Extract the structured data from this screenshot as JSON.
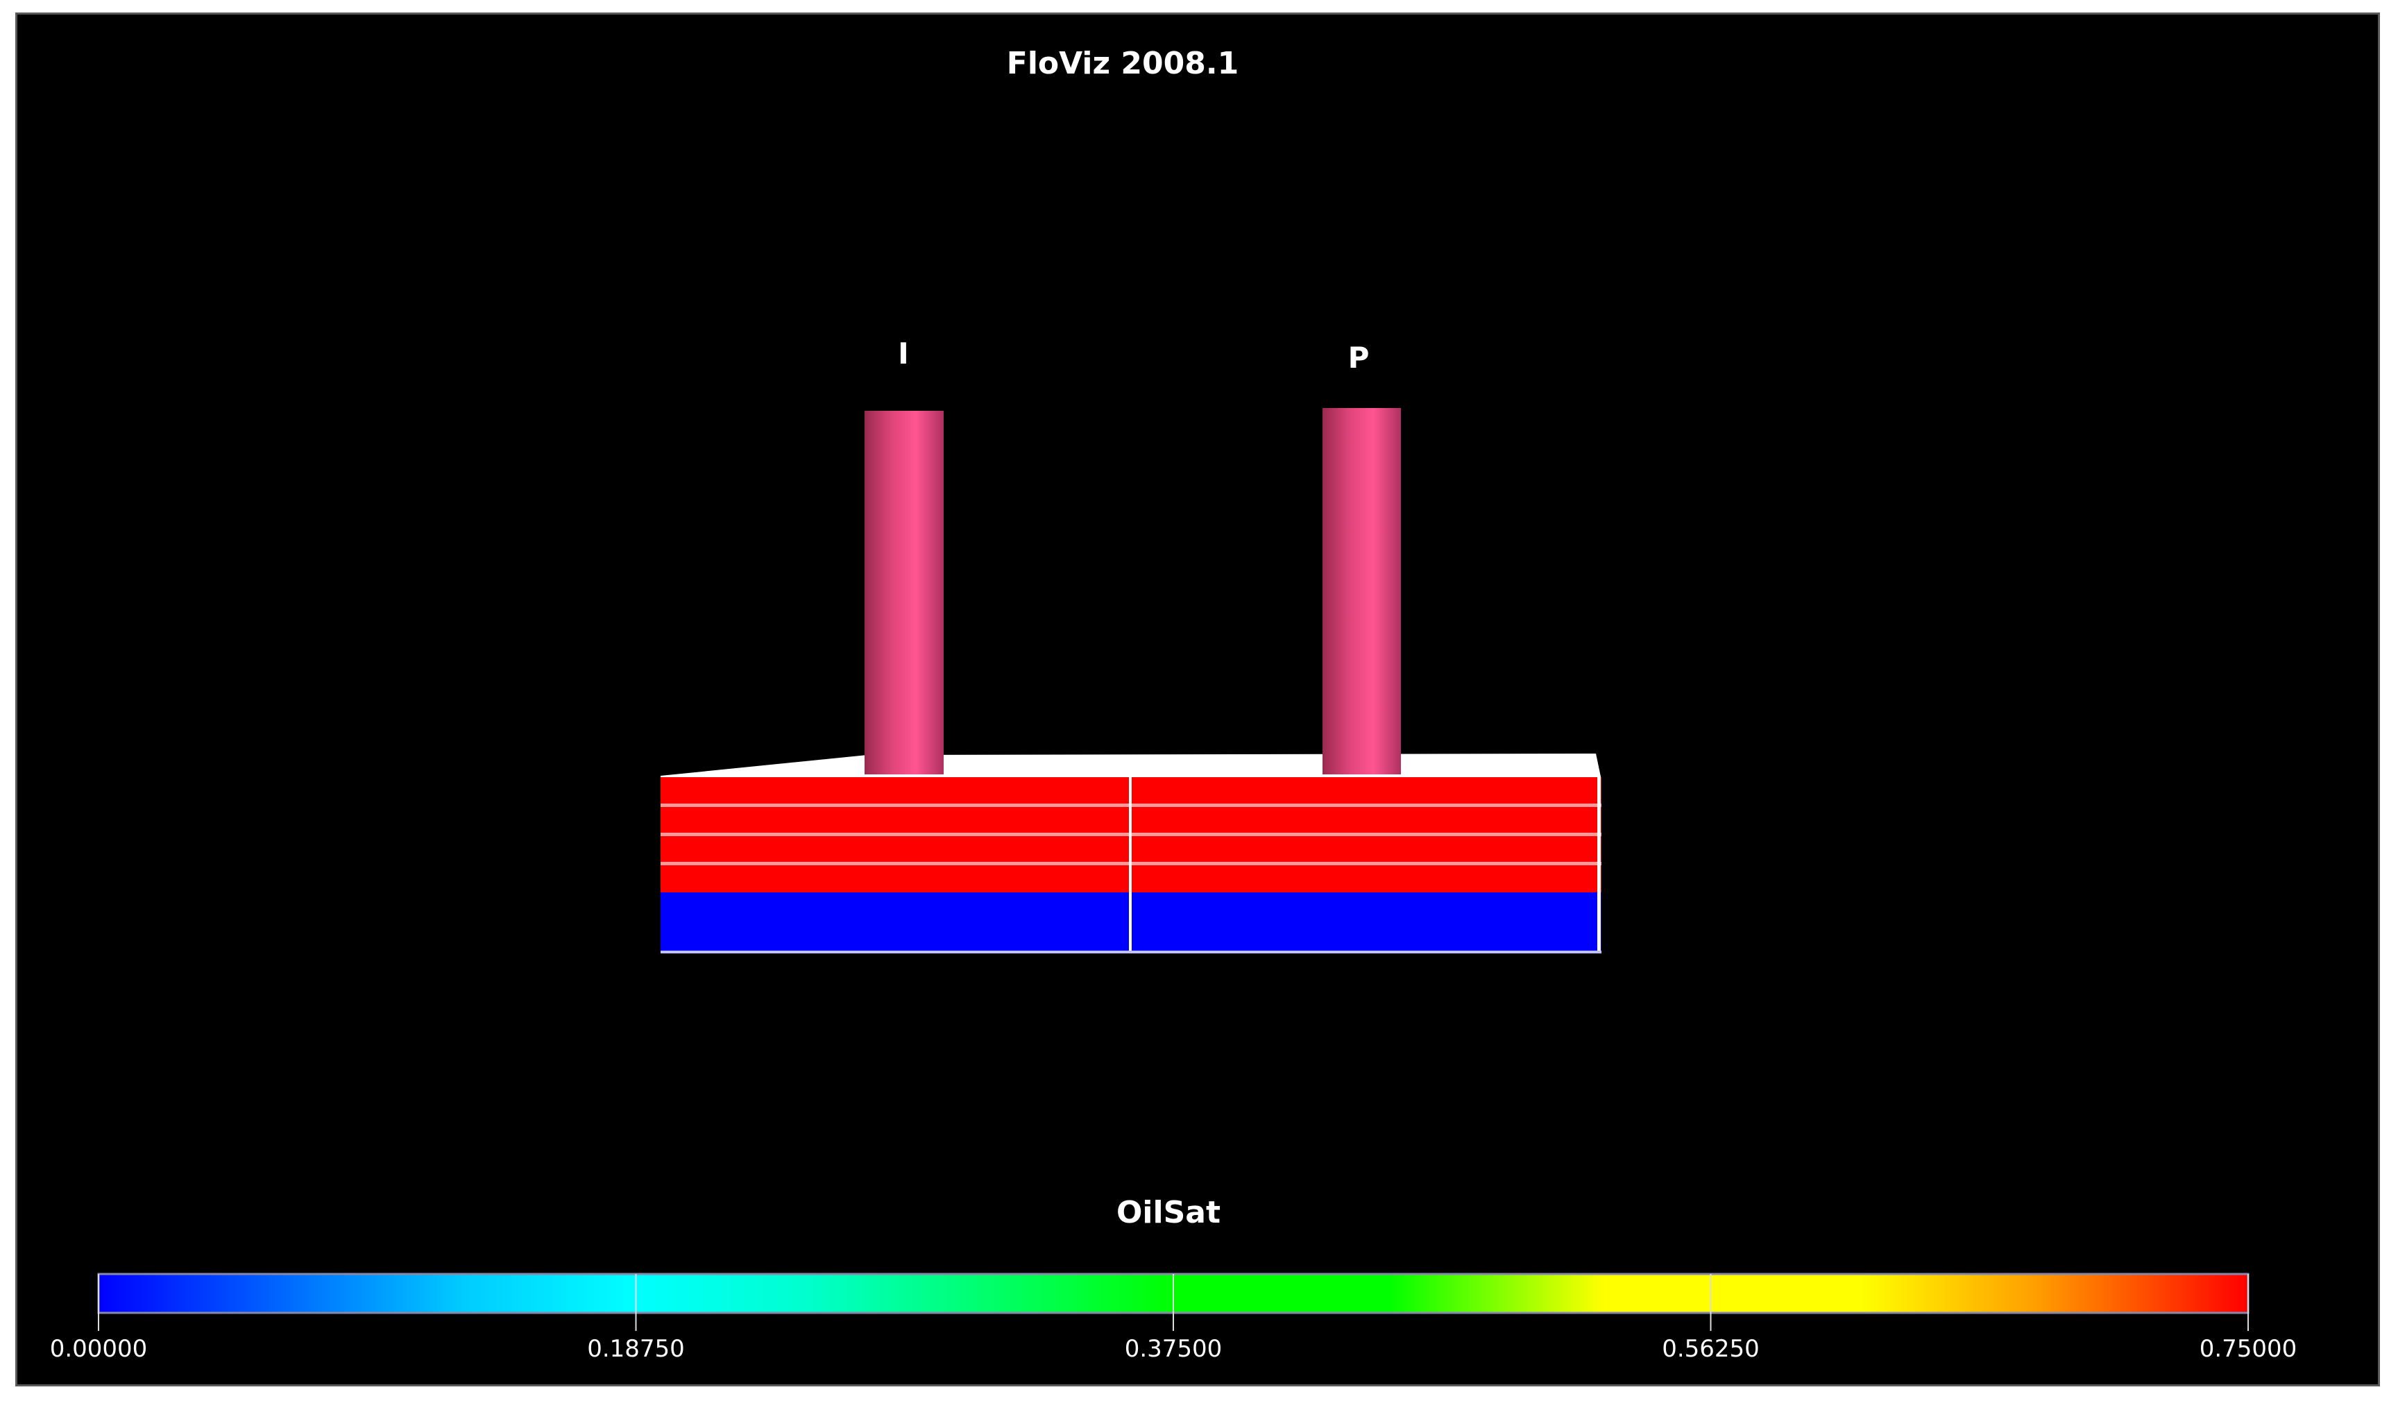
{
  "title": "FloViz 2008.1",
  "wells": [
    {
      "label": "I",
      "color": "#e8457a"
    },
    {
      "label": "P",
      "color": "#e8457a"
    }
  ],
  "reservoir": {
    "upper_layer_color": "#ff0000",
    "lower_layer_color": "#0000ff"
  },
  "colorbar": {
    "property": "OilSat",
    "min": 0.0,
    "max": 0.75,
    "ticks": [
      "0.00000",
      "0.18750",
      "0.37500",
      "0.56250",
      "0.75000"
    ],
    "tick_values": [
      0,
      0.1875,
      0.375,
      0.5625,
      0.75
    ]
  }
}
